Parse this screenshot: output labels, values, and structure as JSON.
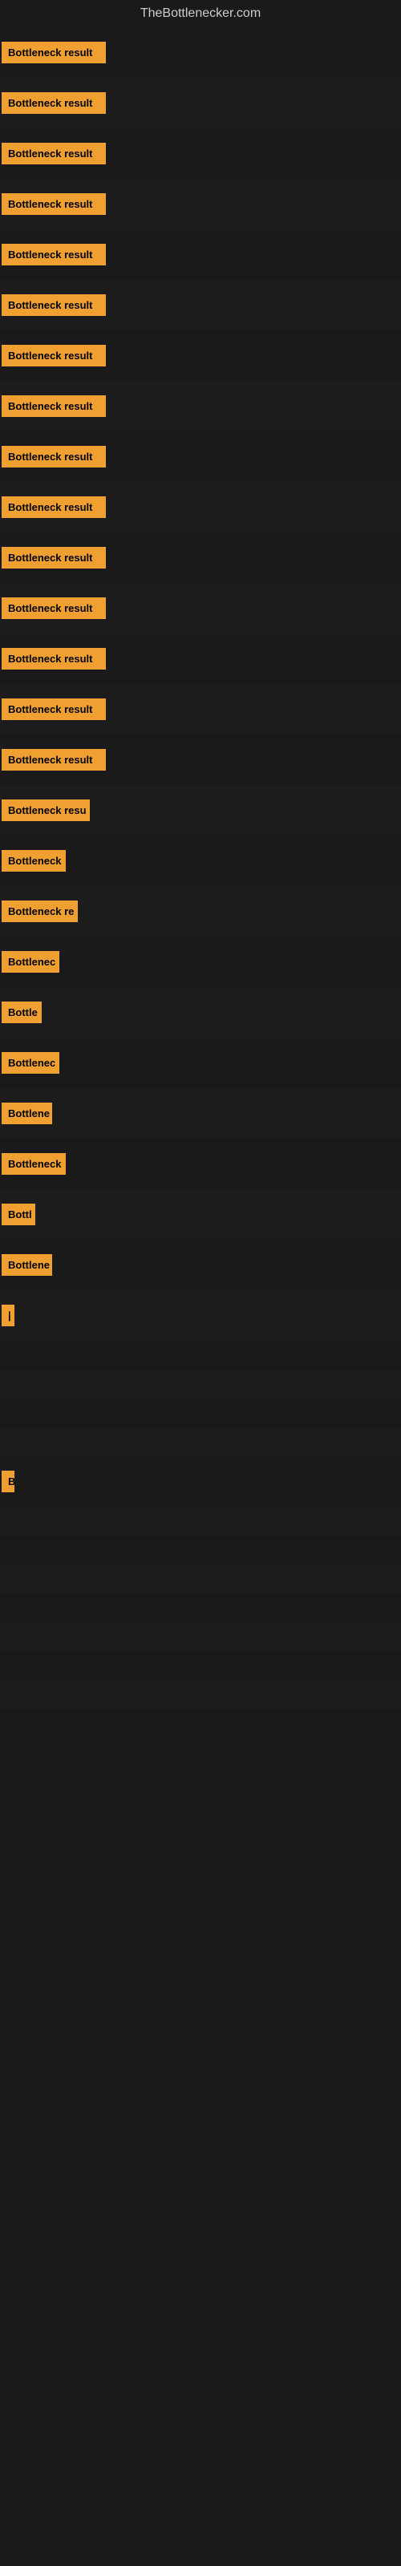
{
  "site": {
    "title": "TheBottlenecker.com"
  },
  "rows": [
    {
      "label": "Bottleneck result",
      "width": 130
    },
    {
      "label": "Bottleneck result",
      "width": 130
    },
    {
      "label": "Bottleneck result",
      "width": 130
    },
    {
      "label": "Bottleneck result",
      "width": 130
    },
    {
      "label": "Bottleneck result",
      "width": 130
    },
    {
      "label": "Bottleneck result",
      "width": 130
    },
    {
      "label": "Bottleneck result",
      "width": 130
    },
    {
      "label": "Bottleneck result",
      "width": 130
    },
    {
      "label": "Bottleneck result",
      "width": 130
    },
    {
      "label": "Bottleneck result",
      "width": 130
    },
    {
      "label": "Bottleneck result",
      "width": 130
    },
    {
      "label": "Bottleneck result",
      "width": 130
    },
    {
      "label": "Bottleneck result",
      "width": 130
    },
    {
      "label": "Bottleneck result",
      "width": 130
    },
    {
      "label": "Bottleneck result",
      "width": 130
    },
    {
      "label": "Bottleneck resu",
      "width": 110
    },
    {
      "label": "Bottleneck",
      "width": 80
    },
    {
      "label": "Bottleneck re",
      "width": 95
    },
    {
      "label": "Bottlenec",
      "width": 72
    },
    {
      "label": "Bottle",
      "width": 50
    },
    {
      "label": "Bottlenec",
      "width": 72
    },
    {
      "label": "Bottlene",
      "width": 63
    },
    {
      "label": "Bottleneck",
      "width": 80
    },
    {
      "label": "Bottl",
      "width": 42
    },
    {
      "label": "Bottlene",
      "width": 63
    },
    {
      "label": "|",
      "width": 12
    },
    {
      "label": "",
      "width": 0
    },
    {
      "label": "",
      "width": 0
    },
    {
      "label": "",
      "width": 0
    },
    {
      "label": "",
      "width": 0
    },
    {
      "label": "B",
      "width": 14
    },
    {
      "label": "",
      "width": 0
    },
    {
      "label": "",
      "width": 0
    },
    {
      "label": "",
      "width": 0
    },
    {
      "label": "",
      "width": 0
    },
    {
      "label": "",
      "width": 0
    },
    {
      "label": "",
      "width": 0
    },
    {
      "label": "",
      "width": 0
    }
  ]
}
